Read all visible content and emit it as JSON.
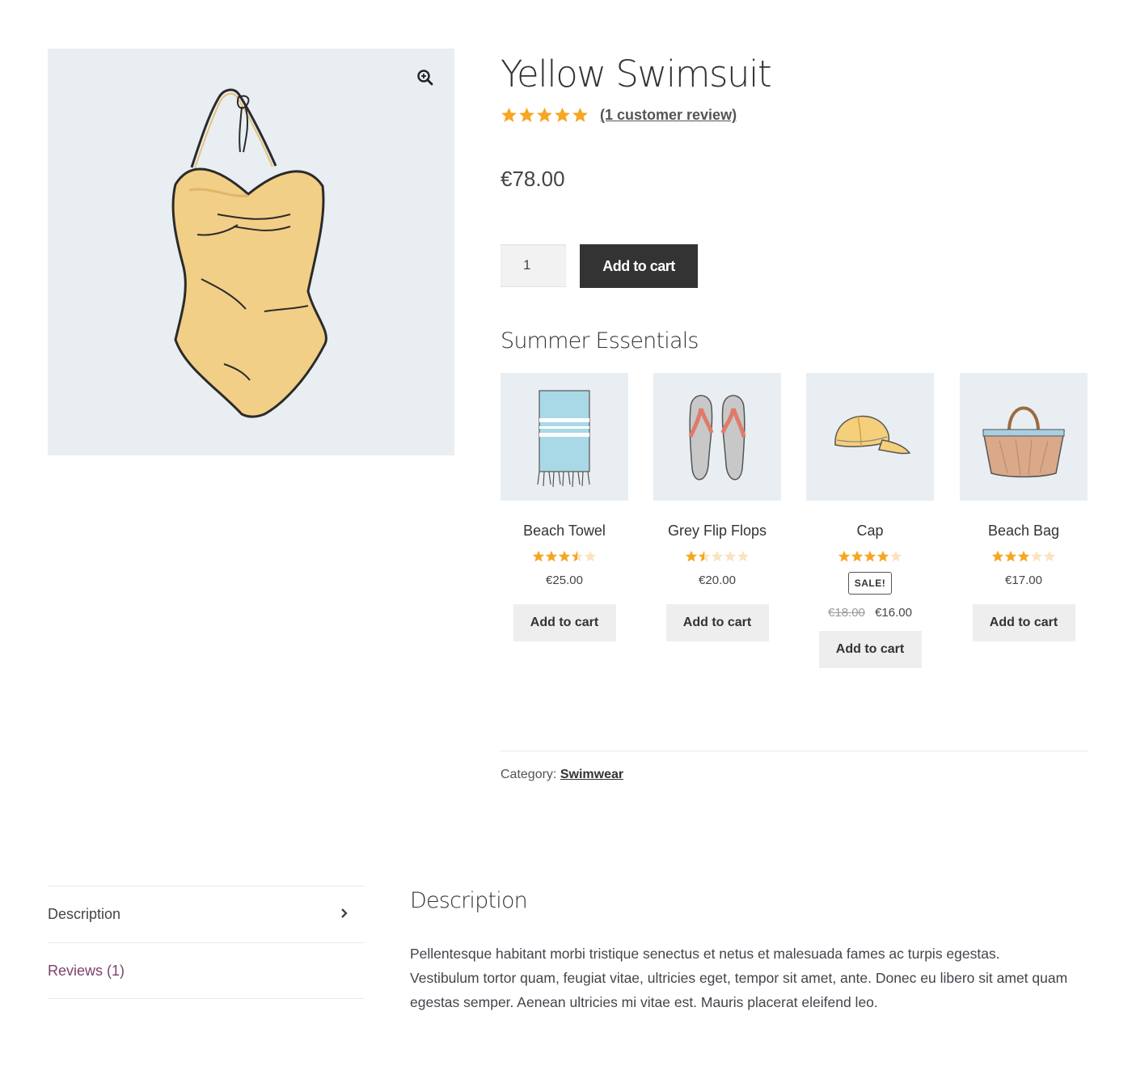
{
  "product": {
    "title": "Yellow Swimsuit",
    "rating": 5,
    "review_link": "(1 customer review)",
    "price": "€78.00",
    "quantity": "1",
    "add_to_cart": "Add to cart",
    "image_icon": "swimsuit-illustration",
    "zoom_icon": "zoom-in-icon"
  },
  "colors": {
    "star": "#f5a623",
    "star_empty": "#fbe3c0",
    "button_dark": "#333333",
    "image_bg": "#e9eef2",
    "reviews_tab": "#7f3f6e"
  },
  "essentials": {
    "title": "Summer Essentials",
    "products": [
      {
        "name": "Beach Towel",
        "rating": 3.5,
        "price": "€25.00",
        "sale": false,
        "cart": "Add to cart",
        "icon": "beach-towel-icon"
      },
      {
        "name": "Grey Flip Flops",
        "rating": 1.5,
        "price": "€20.00",
        "sale": false,
        "cart": "Add to cart",
        "icon": "flip-flops-icon"
      },
      {
        "name": "Cap",
        "rating": 4,
        "sale": true,
        "sale_label": "SALE!",
        "old_price": "€18.00",
        "price": "€16.00",
        "cart": "Add to cart",
        "icon": "cap-icon"
      },
      {
        "name": "Beach Bag",
        "rating": 3,
        "price": "€17.00",
        "sale": false,
        "cart": "Add to cart",
        "icon": "beach-bag-icon"
      }
    ]
  },
  "meta": {
    "category_label": "Category:",
    "category": "Swimwear"
  },
  "tabs": [
    {
      "label": "Description",
      "active": true
    },
    {
      "label": "Reviews (1)",
      "active": false
    }
  ],
  "description": {
    "title": "Description",
    "body": "Pellentesque habitant morbi tristique senectus et netus et malesuada fames ac turpis egestas. Vestibulum tortor quam, feugiat vitae, ultricies eget, tempor sit amet, ante. Donec eu libero sit amet quam egestas semper. Aenean ultricies mi vitae est. Mauris placerat eleifend leo."
  }
}
